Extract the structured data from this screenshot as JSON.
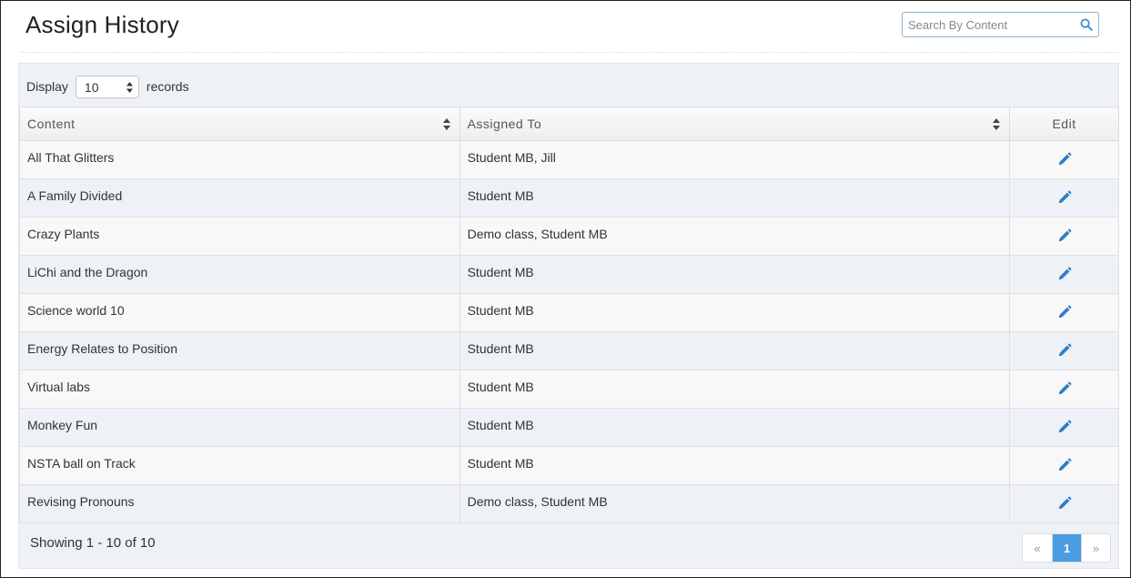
{
  "header": {
    "title": "Assign History",
    "search_placeholder": "Search By Content",
    "search_value": ""
  },
  "display": {
    "prefix": "Display",
    "selected": "10",
    "suffix": "records"
  },
  "table": {
    "columns": {
      "content": "Content",
      "assigned_to": "Assigned To",
      "edit": "Edit"
    },
    "rows": [
      {
        "content": "All That Glitters",
        "assigned_to": "Student MB, Jill"
      },
      {
        "content": "A Family Divided",
        "assigned_to": "Student MB"
      },
      {
        "content": "Crazy Plants",
        "assigned_to": "Demo class, Student MB"
      },
      {
        "content": "LiChi and the Dragon",
        "assigned_to": "Student MB"
      },
      {
        "content": "Science world 10",
        "assigned_to": "Student MB"
      },
      {
        "content": "Energy Relates to Position",
        "assigned_to": "Student MB"
      },
      {
        "content": "Virtual labs",
        "assigned_to": "Student MB"
      },
      {
        "content": "Monkey Fun",
        "assigned_to": "Student MB"
      },
      {
        "content": "NSTA ball on Track",
        "assigned_to": "Student MB"
      },
      {
        "content": "Revising Pronouns",
        "assigned_to": "Demo class, Student MB"
      }
    ]
  },
  "footer": {
    "showing": "Showing 1 - 10 of 10",
    "pager": {
      "prev": "«",
      "current": "1",
      "next": "»"
    }
  },
  "icons": {
    "search": "search-icon",
    "sort": "sort-icon",
    "edit": "pencil-icon"
  },
  "colors": {
    "accent": "#4a9be0",
    "edit_icon": "#2a7fc9",
    "panel_bg": "#eef1f6"
  }
}
